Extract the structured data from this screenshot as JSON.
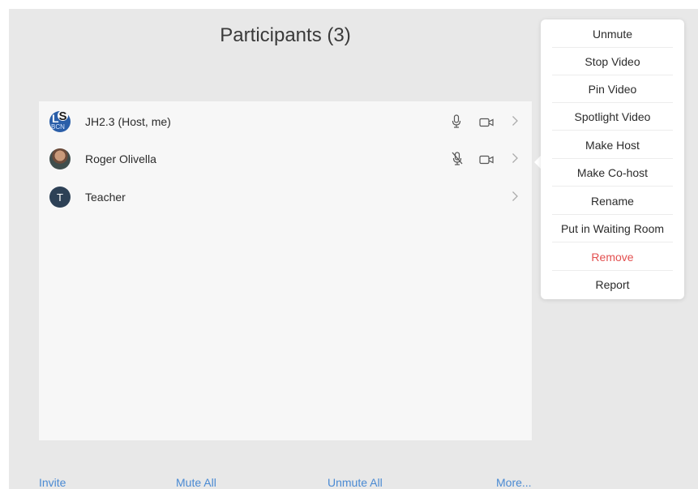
{
  "window": {
    "title": "Participants (3)"
  },
  "participants": [
    {
      "name": "JH2.3 (Host, me)",
      "avatar": "school-logo",
      "mic": "mic-on-icon",
      "video": "video-icon"
    },
    {
      "name": "Roger Olivella",
      "avatar": "photo",
      "mic": "mic-muted-icon",
      "video": "video-icon"
    },
    {
      "name": "Teacher",
      "avatar": "T"
    }
  ],
  "avatar_logo": {
    "l1": "L",
    "l2": "S",
    "l3": "BCN"
  },
  "menu": {
    "items": [
      "Unmute",
      "Stop Video",
      "Pin Video",
      "Spotlight Video",
      "Make Host",
      "Make Co-host",
      "Rename",
      "Put in Waiting Room",
      "Remove",
      "Report"
    ]
  },
  "footer": {
    "invite": "Invite",
    "mute_all": "Mute All",
    "unmute_all": "Unmute All",
    "more": "More..."
  },
  "colors": {
    "link": "#4a8ad3",
    "danger": "#e34f4f",
    "background": "#e8e8e8"
  }
}
